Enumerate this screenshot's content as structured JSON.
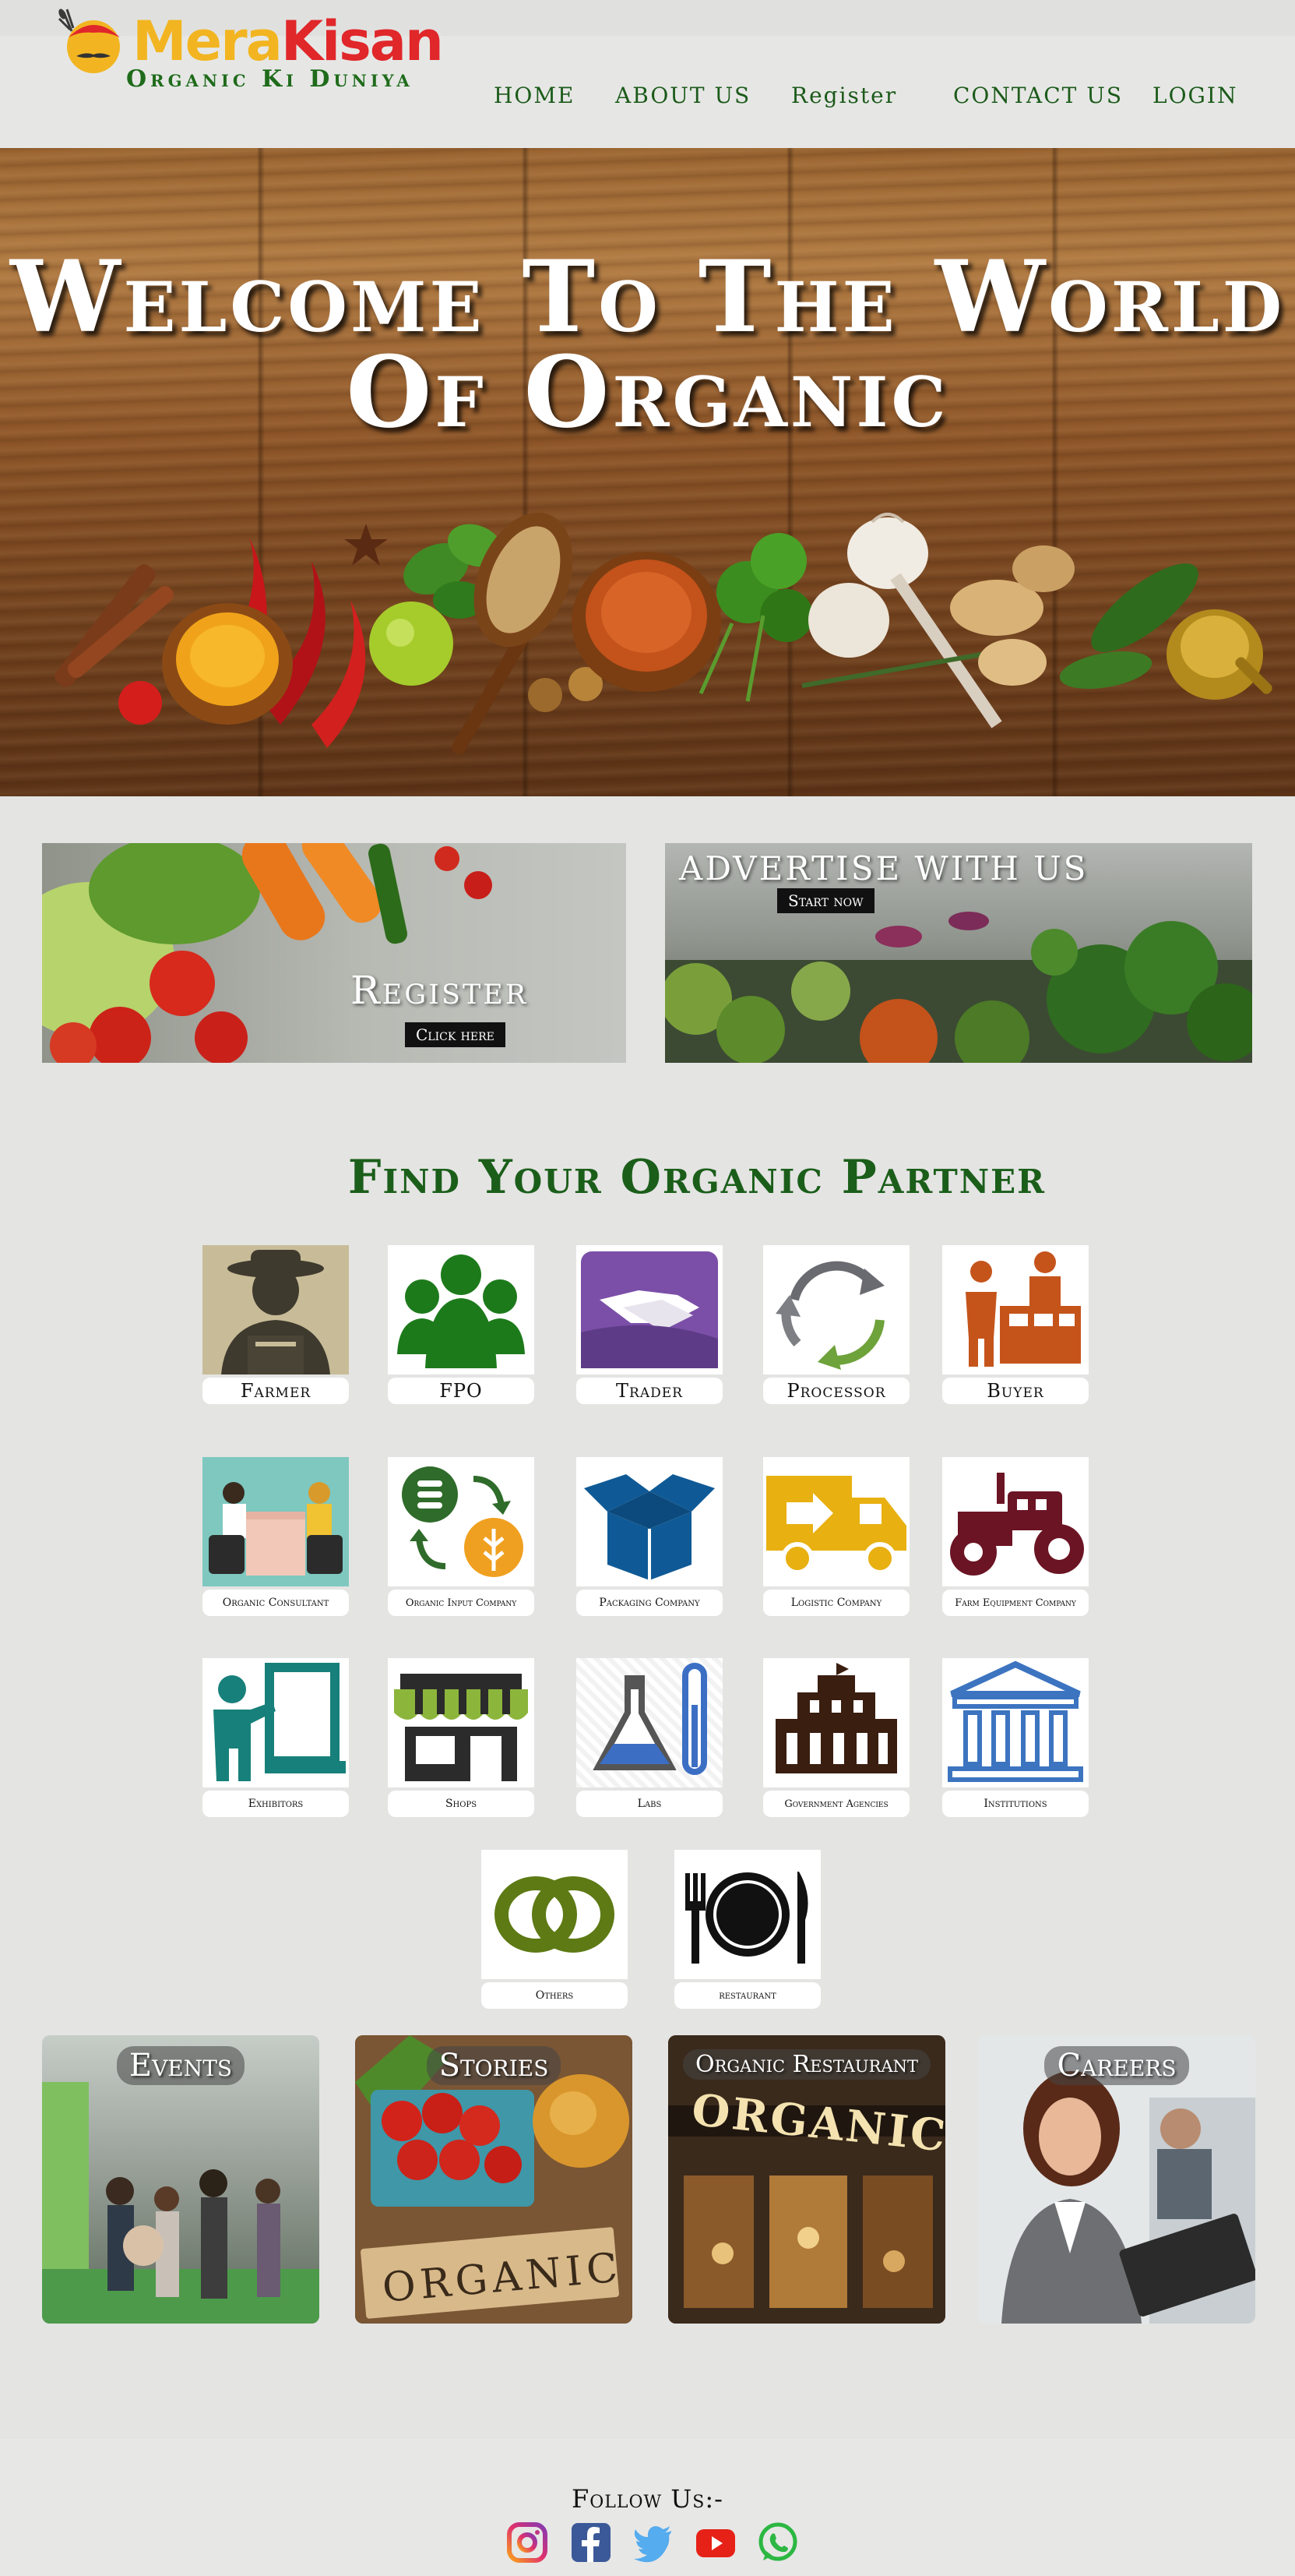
{
  "brand": {
    "name_part1": "Mera",
    "name_part2": "Kisan",
    "tagline": "Organic Ki Duniya",
    "colors": {
      "mera": "#f2b521",
      "kisan": "#e0272a",
      "tagline": "#1f6b1b"
    }
  },
  "nav": [
    {
      "label": "HOME"
    },
    {
      "label": "ABOUT US"
    },
    {
      "label": "Register"
    },
    {
      "label": "CONTACT US"
    },
    {
      "label": "LOGIN"
    }
  ],
  "hero": {
    "line1": "Welcome To The World",
    "line2": "Of Organic"
  },
  "promos": {
    "register": {
      "title": "Register",
      "button": "Click here"
    },
    "advertise": {
      "title": "ADVERTISE WITH US",
      "button": "Start now"
    }
  },
  "partners": {
    "title": "Find Your Organic Partner",
    "items": [
      {
        "label": "Farmer",
        "icon": "farmer-icon"
      },
      {
        "label": "FPO",
        "icon": "group-icon"
      },
      {
        "label": "Trader",
        "icon": "handshake-icon"
      },
      {
        "label": "Processor",
        "icon": "recycle-arrows-icon"
      },
      {
        "label": "Buyer",
        "icon": "market-stall-icon"
      },
      {
        "label": "Organic Consultant",
        "icon": "consultation-icon"
      },
      {
        "label": "Organic Input Company",
        "icon": "input-exchange-icon"
      },
      {
        "label": "Packaging Company",
        "icon": "open-box-icon"
      },
      {
        "label": "Logistic Company",
        "icon": "delivery-truck-icon"
      },
      {
        "label": "Farm Equipment Company",
        "icon": "tractor-icon"
      },
      {
        "label": "Exhibitors",
        "icon": "presenter-board-icon"
      },
      {
        "label": "Shops",
        "icon": "shop-awning-icon"
      },
      {
        "label": "Labs",
        "icon": "lab-flask-icon"
      },
      {
        "label": "Government Agencies",
        "icon": "government-building-icon"
      },
      {
        "label": "Institutions",
        "icon": "institution-columns-icon"
      },
      {
        "label": "Others",
        "icon": "linked-rings-icon"
      },
      {
        "label": "restaurant",
        "icon": "plate-cutlery-icon"
      }
    ]
  },
  "cards": [
    {
      "title": "Events"
    },
    {
      "title": "Stories"
    },
    {
      "title": "Organic Restaurant"
    },
    {
      "title": "Careers"
    }
  ],
  "story_sign": "ORGANIC",
  "restaurant_sign": "ORGANICS",
  "footer": {
    "follow": "Follow Us:-",
    "social": [
      "instagram-icon",
      "facebook-icon",
      "twitter-icon",
      "youtube-icon",
      "whatsapp-icon"
    ]
  }
}
